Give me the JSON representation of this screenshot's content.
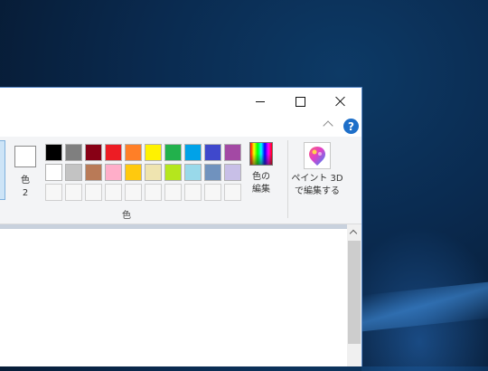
{
  "window": {
    "controls": {
      "minimize": "minimize",
      "maximize": "maximize",
      "close": "close"
    }
  },
  "ribbon": {
    "help_label": "?",
    "color2": {
      "label": "色\n2",
      "value": "#ffffff"
    },
    "palette_group_label": "色",
    "palette": {
      "row1": [
        "#000000",
        "#7f7f7f",
        "#880015",
        "#ed1c24",
        "#ff7f27",
        "#fff200",
        "#22b14c",
        "#00a2e8",
        "#3f48cc",
        "#a349a4"
      ],
      "row2": [
        "#ffffff",
        "#c3c3c3",
        "#b97a57",
        "#ffaec9",
        "#ffc90e",
        "#efe4b0",
        "#b5e61d",
        "#99d9ea",
        "#7092be",
        "#c8bfe7"
      ],
      "row3_custom_count": 10
    },
    "edit_colors": {
      "label": "色の\n編集",
      "icon": "rainbow-palette-icon"
    },
    "paint3d": {
      "label": "ペイント 3D\nで編集する",
      "icon": "paint3d-icon"
    }
  }
}
